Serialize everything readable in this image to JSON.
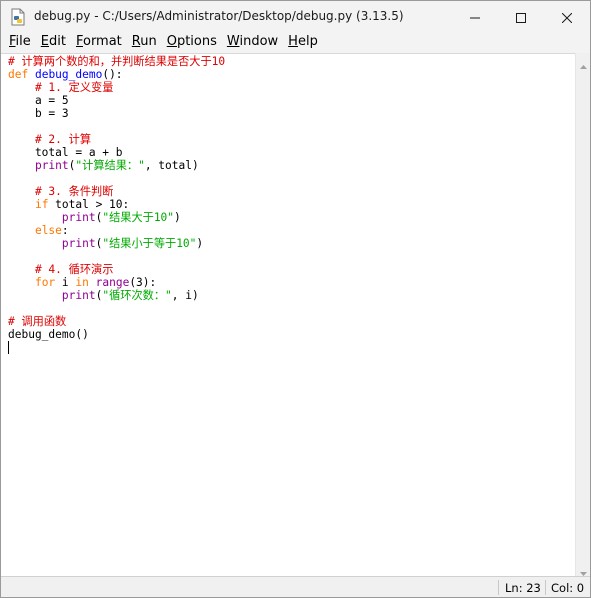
{
  "window": {
    "title": "debug.py - C:/Users/Administrator/Desktop/debug.py (3.13.5)"
  },
  "menu": {
    "items": [
      {
        "label": "File",
        "mnemonic": "F",
        "rest": "ile"
      },
      {
        "label": "Edit",
        "mnemonic": "E",
        "rest": "dit"
      },
      {
        "label": "Format",
        "mnemonic": "F",
        "rest": "ormat"
      },
      {
        "label": "Run",
        "mnemonic": "R",
        "rest": "un"
      },
      {
        "label": "Options",
        "mnemonic": "O",
        "rest": "ptions"
      },
      {
        "label": "Window",
        "mnemonic": "W",
        "rest": "indow"
      },
      {
        "label": "Help",
        "mnemonic": "H",
        "rest": "elp"
      }
    ]
  },
  "editor": {
    "lines": [
      [
        {
          "t": "# 计算两个数的和，并判断结果是否大于10",
          "c": "cm"
        }
      ],
      [
        {
          "t": "def",
          "c": "kw"
        },
        {
          "t": " ",
          "c": ""
        },
        {
          "t": "debug_demo",
          "c": "def"
        },
        {
          "t": "():",
          "c": ""
        }
      ],
      [
        {
          "t": "    ",
          "c": ""
        },
        {
          "t": "# 1. 定义变量",
          "c": "cm"
        }
      ],
      [
        {
          "t": "    a = 5",
          "c": ""
        }
      ],
      [
        {
          "t": "    b = 3",
          "c": ""
        }
      ],
      [
        {
          "t": "",
          "c": ""
        }
      ],
      [
        {
          "t": "    ",
          "c": ""
        },
        {
          "t": "# 2. 计算",
          "c": "cm"
        }
      ],
      [
        {
          "t": "    total = a + b",
          "c": ""
        }
      ],
      [
        {
          "t": "    ",
          "c": ""
        },
        {
          "t": "print",
          "c": "bi"
        },
        {
          "t": "(",
          "c": ""
        },
        {
          "t": "\"计算结果：\"",
          "c": "str"
        },
        {
          "t": ", total)",
          "c": ""
        }
      ],
      [
        {
          "t": "",
          "c": ""
        }
      ],
      [
        {
          "t": "    ",
          "c": ""
        },
        {
          "t": "# 3. 条件判断",
          "c": "cm"
        }
      ],
      [
        {
          "t": "    ",
          "c": ""
        },
        {
          "t": "if",
          "c": "kw"
        },
        {
          "t": " total > 10:",
          "c": ""
        }
      ],
      [
        {
          "t": "        ",
          "c": ""
        },
        {
          "t": "print",
          "c": "bi"
        },
        {
          "t": "(",
          "c": ""
        },
        {
          "t": "\"结果大于10\"",
          "c": "str"
        },
        {
          "t": ")",
          "c": ""
        }
      ],
      [
        {
          "t": "    ",
          "c": ""
        },
        {
          "t": "else",
          "c": "kw"
        },
        {
          "t": ":",
          "c": ""
        }
      ],
      [
        {
          "t": "        ",
          "c": ""
        },
        {
          "t": "print",
          "c": "bi"
        },
        {
          "t": "(",
          "c": ""
        },
        {
          "t": "\"结果小于等于10\"",
          "c": "str"
        },
        {
          "t": ")",
          "c": ""
        }
      ],
      [
        {
          "t": "",
          "c": ""
        }
      ],
      [
        {
          "t": "    ",
          "c": ""
        },
        {
          "t": "# 4. 循环演示",
          "c": "cm"
        }
      ],
      [
        {
          "t": "    ",
          "c": ""
        },
        {
          "t": "for",
          "c": "kw"
        },
        {
          "t": " i ",
          "c": ""
        },
        {
          "t": "in",
          "c": "kw"
        },
        {
          "t": " ",
          "c": ""
        },
        {
          "t": "range",
          "c": "bi"
        },
        {
          "t": "(3):",
          "c": ""
        }
      ],
      [
        {
          "t": "        ",
          "c": ""
        },
        {
          "t": "print",
          "c": "bi"
        },
        {
          "t": "(",
          "c": ""
        },
        {
          "t": "\"循环次数：\"",
          "c": "str"
        },
        {
          "t": ", i)",
          "c": ""
        }
      ],
      [
        {
          "t": "",
          "c": ""
        }
      ],
      [
        {
          "t": "# 调用函数",
          "c": "cm"
        }
      ],
      [
        {
          "t": "debug_demo()",
          "c": ""
        }
      ],
      [
        {
          "t": "",
          "c": ""
        }
      ]
    ]
  },
  "status": {
    "line": "Ln: 23",
    "col": "Col: 0"
  },
  "colors": {
    "keyword": "#ff7700",
    "definition": "#0000ff",
    "builtin": "#900090",
    "string": "#00aa00",
    "comment": "#dd0000"
  },
  "icons": {
    "app": "python-file-icon",
    "minimize": "minimize-icon",
    "maximize": "maximize-icon",
    "close": "close-icon"
  }
}
